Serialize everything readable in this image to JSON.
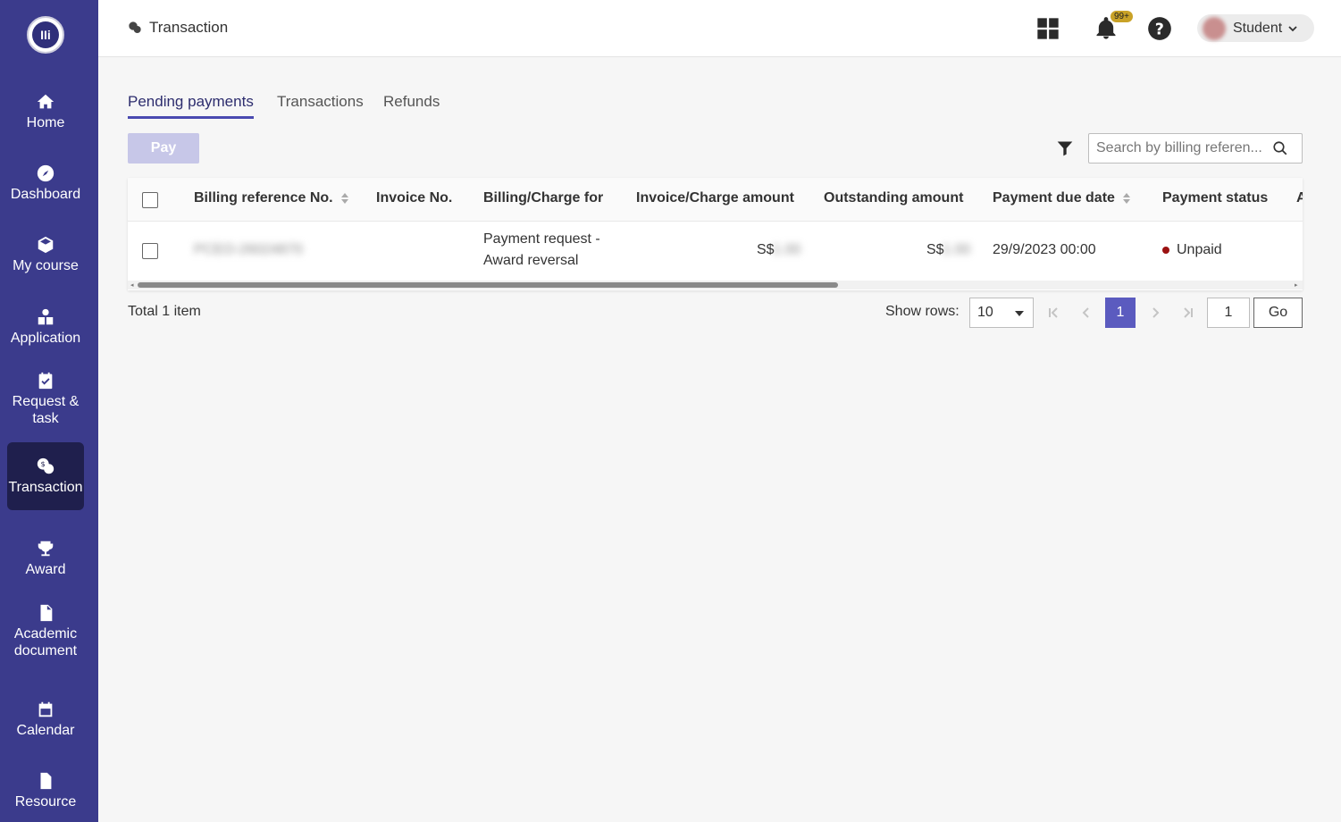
{
  "sidebar": {
    "logo_text": "IIi",
    "items": [
      {
        "label": "Home",
        "icon": "home-icon"
      },
      {
        "label": "Dashboard",
        "icon": "compass-icon"
      },
      {
        "label": "My course",
        "icon": "box-icon"
      },
      {
        "label": "Application",
        "icon": "apply-icon"
      },
      {
        "label": "Request &\ntask",
        "icon": "calendar-check-icon"
      },
      {
        "label": "Transaction",
        "icon": "transaction-icon"
      },
      {
        "label": "Award",
        "icon": "trophy-icon"
      },
      {
        "label": "Academic\ndocument",
        "icon": "pdf-icon"
      },
      {
        "label": "Calendar",
        "icon": "calendar-icon"
      },
      {
        "label": "Resource",
        "icon": "file-icon"
      }
    ]
  },
  "header": {
    "title": "Transaction",
    "notification_badge": "99+",
    "user_name": "Student"
  },
  "tabs": [
    {
      "label": "Pending payments",
      "active": true
    },
    {
      "label": "Transactions",
      "active": false
    },
    {
      "label": "Refunds",
      "active": false
    }
  ],
  "toolbar": {
    "pay_label": "Pay",
    "search_placeholder": "Search by billing referen..."
  },
  "table": {
    "columns": [
      "Billing reference No.",
      "Invoice No.",
      "Billing/Charge for",
      "Invoice/Charge amount",
      "Outstanding amount",
      "Payment due date",
      "Payment status",
      "A"
    ],
    "rows": [
      {
        "billing_ref": "PCEO-26024870",
        "invoice_no": "",
        "charge_for_line1": "Payment request -",
        "charge_for_line2": "Award reversal",
        "currency": "S$",
        "invoice_amount": "1.00",
        "outstanding_amount": "1.00",
        "due_date": "29/9/2023 00:00",
        "status": "Unpaid"
      }
    ]
  },
  "footer": {
    "total": "Total 1 item",
    "show_rows_label": "Show rows:",
    "rows_value": "10",
    "current_page": "1",
    "goto_value": "1",
    "go_label": "Go"
  },
  "colors": {
    "sidebar": "#3b3b8c",
    "active_nav": "#1f1f4d",
    "accent": "#5b5bbf",
    "unpaid": "#9b1111"
  }
}
